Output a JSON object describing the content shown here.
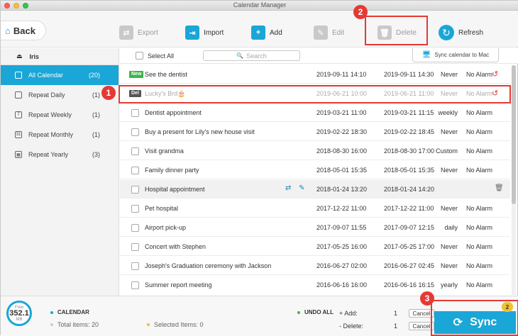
{
  "window": {
    "title": "Calendar Manager"
  },
  "toolbar": {
    "back": "Back",
    "export": "Export",
    "import": "Import",
    "add": "Add",
    "edit": "Edit",
    "delete": "Delete",
    "refresh": "Refresh"
  },
  "annotations": {
    "step1": "1",
    "step2": "2",
    "step3": "3"
  },
  "sidebar": {
    "account": "Iris",
    "items": [
      {
        "label": "All Calendar",
        "count": "(20)"
      },
      {
        "label": "Repeat Daily",
        "count": "(1)"
      },
      {
        "label": "Repeat Weekly",
        "count": "(1)"
      },
      {
        "label": "Repeat Monthly",
        "count": "(1)"
      },
      {
        "label": "Repeat Yearly",
        "count": "(3)"
      }
    ]
  },
  "list_header": {
    "select_all": "Select All",
    "search_placeholder": "Search",
    "sync_to_mac": "Sync calendar to Mac"
  },
  "rows": [
    {
      "tag": "New",
      "title": "See the dentist",
      "start": "2019-09-11 14:10",
      "end": "2019-09-11 14:30",
      "repeat": "Never",
      "alarm": "No Alarm"
    },
    {
      "tag": "Del",
      "title": "Lucky's Brd🎂",
      "start": "2019-06-21 10:00",
      "end": "2019-06-21 11:00",
      "repeat": "Never",
      "alarm": "No Alarm"
    },
    {
      "tag": "",
      "title": "Dentist appointment",
      "start": "2019-03-21 11:00",
      "end": "2019-03-21 11:15",
      "repeat": "weekly",
      "alarm": "No Alarm"
    },
    {
      "tag": "",
      "title": "Buy a present for Lily's new house visit",
      "start": "2019-02-22 18:30",
      "end": "2019-02-22 18:45",
      "repeat": "Never",
      "alarm": "No Alarm"
    },
    {
      "tag": "",
      "title": "Visit grandma",
      "start": "2018-08-30 16:00",
      "end": "2018-08-30 17:00",
      "repeat": "Custom",
      "alarm": "No Alarm"
    },
    {
      "tag": "",
      "title": "Family dinner party",
      "start": "2018-05-01 15:35",
      "end": "2018-05-01 15:35",
      "repeat": "Never",
      "alarm": "No Alarm"
    },
    {
      "tag": "",
      "title": "Hospital appointment",
      "start": "2018-01-24 13:20",
      "end": "2018-01-24 14:20",
      "repeat": "",
      "alarm": ""
    },
    {
      "tag": "",
      "title": "Pet hospital",
      "start": "2017-12-22 11:00",
      "end": "2017-12-22 11:00",
      "repeat": "Never",
      "alarm": "No Alarm"
    },
    {
      "tag": "",
      "title": "Airport pick-up",
      "start": "2017-09-07 11:55",
      "end": "2017-09-07 12:15",
      "repeat": "daily",
      "alarm": "No Alarm"
    },
    {
      "tag": "",
      "title": "Concert with Stephen",
      "start": "2017-05-25 16:00",
      "end": "2017-05-25 17:00",
      "repeat": "Never",
      "alarm": "No Alarm"
    },
    {
      "tag": "",
      "title": "Joseph's Graduation ceremony with Jackson",
      "start": "2016-06-27 02:00",
      "end": "2016-06-27 02:45",
      "repeat": "Never",
      "alarm": "No Alarm"
    },
    {
      "tag": "",
      "title": "Summer report meeting",
      "start": "2016-06-16 16:00",
      "end": "2016-06-16 16:15",
      "repeat": "yearly",
      "alarm": "No Alarm"
    }
  ],
  "footer": {
    "storage_free": "Free",
    "storage_value": "352.1",
    "storage_unit": "MB",
    "calendar_label": "CALENDAR",
    "total_items": "Total items: 20",
    "selected_items": "Selected Items: 0",
    "undo_all": "UNDO ALL",
    "add_label": "+ Add:",
    "add_count": "1",
    "delete_label": "- Delete:",
    "delete_count": "1",
    "cancel": "Cancel",
    "sync": "Sync",
    "sync_badge": "2"
  },
  "colors": {
    "accent": "#1aa6d6",
    "annotation": "#e53935",
    "new_tag": "#3bb54a",
    "badge": "#f2c12e"
  }
}
